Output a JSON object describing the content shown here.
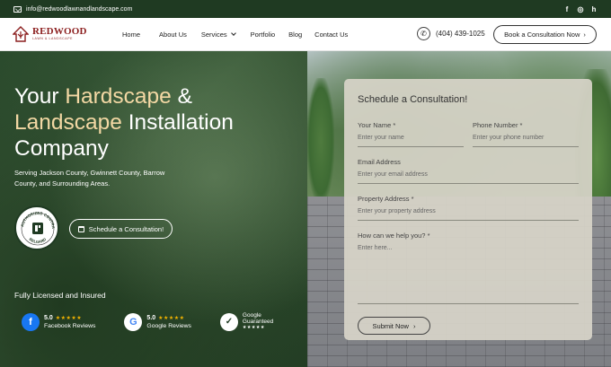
{
  "topbar": {
    "email": "info@redwoodlawnandlandscape.com",
    "social": [
      "f",
      "◎",
      "h"
    ]
  },
  "header": {
    "logo_name": "REDWOOD",
    "logo_sub": "LAWN & LANDSCAPE",
    "nav": [
      "Home",
      "About Us",
      "Services",
      "Portfolio",
      "Blog",
      "Contact Us"
    ],
    "phone": "(404) 439-1025",
    "cta": "Book a Consultation Now",
    "cta_arrow": "›"
  },
  "hero": {
    "title_1": "Your ",
    "title_accent_1": "Hardscape",
    "title_2": " &",
    "title_accent_2": "Landscape",
    "title_3": " Installation Company",
    "subtitle": "Serving Jackson County, Gwinnett County, Barrow County, and Surrounding Areas.",
    "badge_top": "AUTHORIZED CONTRACTOR",
    "badge_bottom": "BELGARD",
    "button": "Schedule a Consultation!",
    "licensed": "Fully Licensed and Insured",
    "reviews": [
      {
        "score": "5.0",
        "stars": "★★★★★",
        "label": "Facebook Reviews",
        "icon": "f"
      },
      {
        "score": "5.0",
        "stars": "★★★★★",
        "label": "Google Reviews",
        "icon": "G"
      }
    ],
    "guaranteed": {
      "line1": "Google",
      "line2": "Guaranteed",
      "stars": "★★★★★"
    }
  },
  "form": {
    "title": "Schedule a Consultation!",
    "name_label": "Your Name",
    "name_placeholder": "Enter your name",
    "phone_label": "Phone Number",
    "phone_placeholder": "Enter your phone number",
    "email_label": "Email Address",
    "email_placeholder": "Enter your email address",
    "address_label": "Property Address",
    "address_placeholder": "Enter your property address",
    "help_label": "How can we help you?",
    "help_placeholder": "Enter here...",
    "required_mark": "*",
    "submit": "Submit Now",
    "submit_arrow": "›"
  }
}
